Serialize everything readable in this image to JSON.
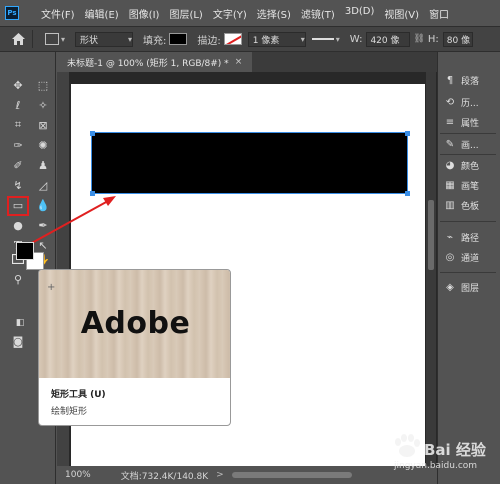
{
  "app": {
    "logo": "Ps"
  },
  "menu": [
    "文件(F)",
    "编辑(E)",
    "图像(I)",
    "图层(L)",
    "文字(Y)",
    "选择(S)",
    "滤镜(T)",
    "3D(D)",
    "视图(V)",
    "窗口"
  ],
  "options": {
    "shape_mode": "形状",
    "fill_label": "填充:",
    "stroke_label": "描边:",
    "stroke_width": "1 像素",
    "w_label": "W:",
    "w_value": "420 像",
    "h_label": "H:",
    "h_value": "80 像"
  },
  "document": {
    "tab_title": "未标题-1 @ 100% (矩形 1, RGB/8#) *",
    "close_symbol": "×"
  },
  "status": {
    "zoom": "100%",
    "doc_info": "文档:732.4K/140.8K",
    "arrow": ">"
  },
  "tooltip": {
    "image_text": "Adobe",
    "title": "矩形工具 (U)",
    "description": "绘制矩形"
  },
  "right_panels": [
    {
      "icon": "paragraph-icon",
      "glyph": "¶",
      "label": "段落"
    },
    {
      "icon": "history-icon",
      "glyph": "⟲",
      "label": "历..."
    },
    {
      "icon": "properties-icon",
      "glyph": "≡",
      "label": "属性"
    },
    {
      "icon": "brush-icon",
      "glyph": "✎",
      "label": "画..."
    },
    {
      "icon": "color-icon",
      "glyph": "◕",
      "label": "颜色"
    },
    {
      "icon": "swatches-icon",
      "glyph": "▦",
      "label": "画笔"
    },
    {
      "icon": "swatch-grid-icon",
      "glyph": "▥",
      "label": "色板"
    },
    {
      "icon": "paths-icon",
      "glyph": "⌁",
      "label": "路径"
    },
    {
      "icon": "channels-icon",
      "glyph": "◎",
      "label": "通道"
    },
    {
      "icon": "layers-icon",
      "glyph": "◈",
      "label": "图层"
    }
  ],
  "watermark": {
    "main": "Bai 经验",
    "sub": "jingyan.baidu.com"
  },
  "colors": {
    "accent": "#e02020",
    "selection": "#3a8ee6",
    "foreground": "#000000",
    "background": "#ffffff"
  }
}
